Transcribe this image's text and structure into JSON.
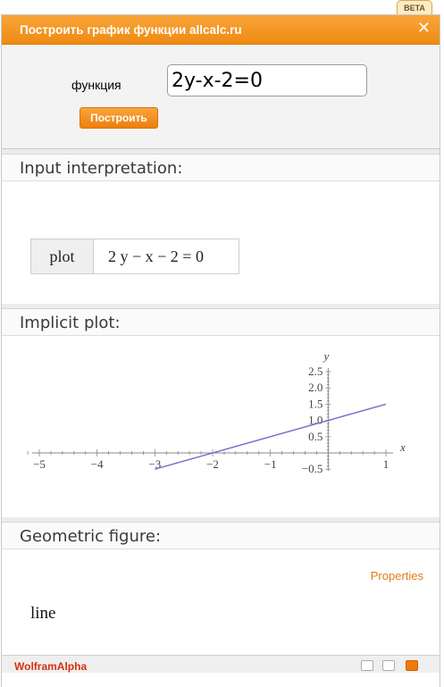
{
  "badge": "BETA",
  "window": {
    "title": "Построить график функции allcalc.ru",
    "close_icon": "close-icon"
  },
  "form": {
    "label": "функция",
    "input_value": "2y-x-2=0",
    "button_label": "Построить"
  },
  "pods": {
    "interpretation": {
      "title": "Input interpretation:",
      "cells": [
        "plot",
        "2 y − x − 2 = 0"
      ]
    },
    "plot": {
      "title": "Implicit plot:"
    },
    "geometric": {
      "title": "Geometric figure:",
      "properties_link": "Properties",
      "value": "line"
    }
  },
  "chart_data": {
    "type": "line",
    "xlabel": "x",
    "ylabel": "y",
    "xlim": [
      -5.1,
      1.0
    ],
    "ylim": [
      -0.55,
      2.5
    ],
    "x_ticks": [
      -5,
      -4,
      -3,
      -2,
      -1,
      1
    ],
    "y_ticks": [
      -0.5,
      0.5,
      1.0,
      1.5,
      2.0,
      2.5
    ],
    "x_tick_labels": [
      "−5",
      "−4",
      "−3",
      "−2",
      "−1",
      "1"
    ],
    "y_tick_labels": [
      "−0.5",
      "0.5",
      "1.0",
      "1.5",
      "2.0",
      "2.5"
    ],
    "line_color": "#6f6fce",
    "series": [
      {
        "x": [
          -3.0,
          1.0
        ],
        "y": [
          -0.5,
          1.5
        ]
      }
    ]
  },
  "footer": {
    "brand": "WolframAlpha"
  }
}
